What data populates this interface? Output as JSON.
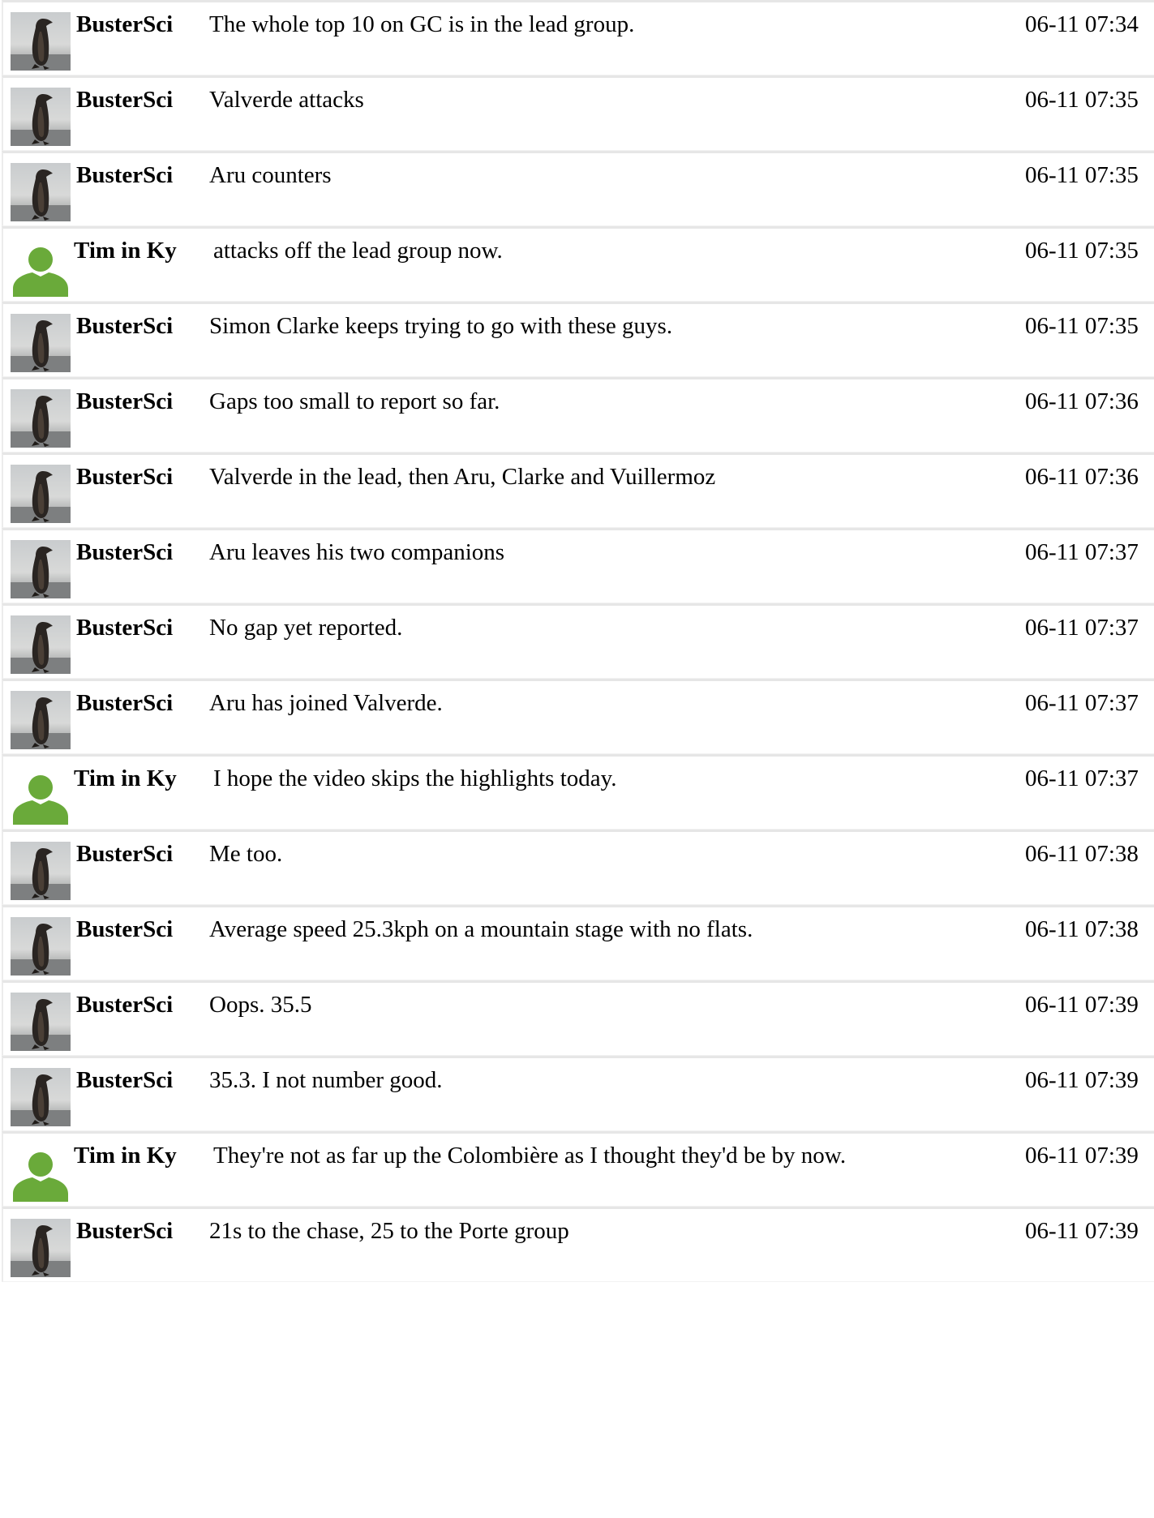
{
  "messages": [
    {
      "user": "BusterSci",
      "avatar": "penguin-avatar",
      "text": "The whole top 10 on GC is in the lead group.",
      "time": "06-11 07:34"
    },
    {
      "user": "BusterSci",
      "avatar": "penguin-avatar",
      "text": "Valverde attacks",
      "time": "06-11 07:35"
    },
    {
      "user": "BusterSci",
      "avatar": "penguin-avatar",
      "text": "Aru counters",
      "time": "06-11 07:35"
    },
    {
      "user": "Tim in Ky",
      "avatar": "default-user-avatar",
      "text": "attacks off the lead group now.",
      "time": "06-11 07:35"
    },
    {
      "user": "BusterSci",
      "avatar": "penguin-avatar",
      "text": "Simon Clarke keeps trying to go with these guys.",
      "time": "06-11 07:35"
    },
    {
      "user": "BusterSci",
      "avatar": "penguin-avatar",
      "text": "Gaps too small to report so far.",
      "time": "06-11 07:36"
    },
    {
      "user": "BusterSci",
      "avatar": "penguin-avatar",
      "text": "Valverde in the lead, then Aru, Clarke and Vuillermoz",
      "time": "06-11 07:36"
    },
    {
      "user": "BusterSci",
      "avatar": "penguin-avatar",
      "text": "Aru leaves his two companions",
      "time": "06-11 07:37"
    },
    {
      "user": "BusterSci",
      "avatar": "penguin-avatar",
      "text": "No gap yet reported.",
      "time": "06-11 07:37"
    },
    {
      "user": "BusterSci",
      "avatar": "penguin-avatar",
      "text": "Aru has joined Valverde.",
      "time": "06-11 07:37"
    },
    {
      "user": "Tim in Ky",
      "avatar": "default-user-avatar",
      "text": "I hope the video skips the highlights today.",
      "time": "06-11 07:37"
    },
    {
      "user": "BusterSci",
      "avatar": "penguin-avatar",
      "text": "Me too.",
      "time": "06-11 07:38"
    },
    {
      "user": "BusterSci",
      "avatar": "penguin-avatar",
      "text": "Average speed 25.3kph on a mountain stage with no flats.",
      "time": "06-11 07:38"
    },
    {
      "user": "BusterSci",
      "avatar": "penguin-avatar",
      "text": "Oops. 35.5",
      "time": "06-11 07:39"
    },
    {
      "user": "BusterSci",
      "avatar": "penguin-avatar",
      "text": "35.3. I not number good.",
      "time": "06-11 07:39"
    },
    {
      "user": "Tim in Ky",
      "avatar": "default-user-avatar",
      "text": "They're not as far up the Colombière as I thought they'd be by now.",
      "time": "06-11 07:39"
    },
    {
      "user": "BusterSci",
      "avatar": "penguin-avatar",
      "text": "21s to the chase, 25 to the Porte group",
      "time": "06-11 07:39"
    }
  ],
  "colors": {
    "default_avatar": "#6aaa3a",
    "row_border": "#e6e6e6"
  }
}
